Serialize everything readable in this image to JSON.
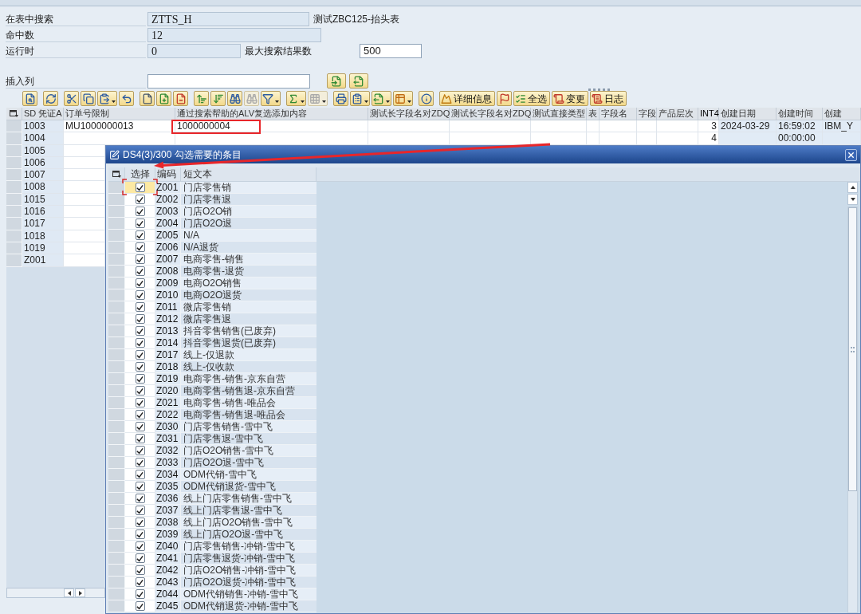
{
  "form": {
    "table_search": {
      "label": "在表中搜索",
      "value": "ZTTS_H",
      "read_only": true,
      "description": "测试ZBC125-抬头表"
    },
    "hit_count": {
      "label": "命中数",
      "value": "12",
      "read_only": true
    },
    "runtime": {
      "label": "运行时",
      "value": "0",
      "read_only": true
    },
    "max_results": {
      "label": "最大搜索结果数",
      "value": "500",
      "read_only": false
    },
    "insert_column": {
      "label": "插入列",
      "read_only": false
    }
  },
  "toolbar": {
    "items": [
      {
        "kind": "icon",
        "disabled": false
      },
      {
        "kind": "icon",
        "disabled": false
      },
      {
        "kind": "icon",
        "disabled": false
      },
      {
        "kind": "icon",
        "disabled": false
      },
      {
        "kind": "icon",
        "disabled": false
      },
      {
        "kind": "icon",
        "disabled": false
      },
      {
        "kind": "icon",
        "disabled": false
      },
      {
        "kind": "icon",
        "disabled": false
      },
      {
        "kind": "icon",
        "disabled": false
      },
      {
        "kind": "icon",
        "disabled": false
      },
      {
        "kind": "icon",
        "disabled": false
      },
      {
        "kind": "icon",
        "disabled": false
      },
      {
        "kind": "icon",
        "disabled": true
      },
      {
        "kind": "icon",
        "disabled": false
      },
      {
        "kind": "icon",
        "disabled": false
      },
      {
        "kind": "icon",
        "disabled": true
      },
      {
        "kind": "icon",
        "disabled": false
      },
      {
        "kind": "icon",
        "disabled": false
      },
      {
        "kind": "icon",
        "disabled": false
      },
      {
        "kind": "icon",
        "disabled": false
      },
      {
        "kind": "icon",
        "disabled": false
      },
      {
        "kind": "text",
        "label": "详细信息",
        "disabled": false
      },
      {
        "kind": "icon",
        "disabled": false
      },
      {
        "kind": "text",
        "label": "全选",
        "disabled": false
      },
      {
        "kind": "text",
        "label": "变更",
        "disabled": false
      },
      {
        "kind": "text",
        "label": "日志",
        "disabled": false
      }
    ]
  },
  "table": {
    "columns": [
      "SD 凭证A",
      "订单号限制",
      "通过搜索帮助的ALV复选添加内容",
      "测试长字段名对ZDQ",
      "测试长字段名对ZDQ",
      "测试直接类型",
      "表",
      "字段名",
      "字段",
      "产品层次",
      "INT4",
      "创建日期",
      "创建时间",
      "创建"
    ],
    "rows": [
      {
        "sd_document": "1003",
        "order_number": "MU1000000013",
        "alv_content": "1000000004",
        "int4": "3",
        "created_date": "2024-03-29",
        "created_time": "16:59:02",
        "created_by": "IBM_Y"
      },
      {
        "sd_document": "1004",
        "int4": "4",
        "created_time": "00:00:00"
      },
      {
        "sd_document": "1005"
      },
      {
        "sd_document": "1006"
      },
      {
        "sd_document": "1007"
      },
      {
        "sd_document": "1008"
      },
      {
        "sd_document": "1015"
      },
      {
        "sd_document": "1016"
      },
      {
        "sd_document": "1017"
      },
      {
        "sd_document": "1018"
      },
      {
        "sd_document": "1019"
      },
      {
        "sd_document": "Z001"
      }
    ]
  },
  "dialog": {
    "title": "DS4(3)/300 勾选需要的条目",
    "columns": [
      "选择",
      "编码",
      "短文本"
    ],
    "rows": [
      {
        "code": "Z001",
        "text": "门店零售销",
        "checked": true,
        "focused": true
      },
      {
        "code": "Z002",
        "text": "门店零售退",
        "checked": true,
        "focused": false
      },
      {
        "code": "Z003",
        "text": "门店O2O销",
        "checked": true,
        "focused": false
      },
      {
        "code": "Z004",
        "text": "门店O2O退",
        "checked": true,
        "focused": false
      },
      {
        "code": "Z005",
        "text": "N/A",
        "checked": true,
        "focused": false
      },
      {
        "code": "Z006",
        "text": "N/A退货",
        "checked": true,
        "focused": false
      },
      {
        "code": "Z007",
        "text": "电商零售-销售",
        "checked": true,
        "focused": false
      },
      {
        "code": "Z008",
        "text": "电商零售-退货",
        "checked": true,
        "focused": false
      },
      {
        "code": "Z009",
        "text": "电商O2O销售",
        "checked": true,
        "focused": false
      },
      {
        "code": "Z010",
        "text": "电商O2O退货",
        "checked": true,
        "focused": false
      },
      {
        "code": "Z011",
        "text": "微店零售销",
        "checked": true,
        "focused": false
      },
      {
        "code": "Z012",
        "text": "微店零售退",
        "checked": true,
        "focused": false
      },
      {
        "code": "Z013",
        "text": "抖音零售销售(已废弃)",
        "checked": true,
        "focused": false
      },
      {
        "code": "Z014",
        "text": "抖音零售退货(已废弃)",
        "checked": true,
        "focused": false
      },
      {
        "code": "Z017",
        "text": "线上-仅退款",
        "checked": true,
        "focused": false
      },
      {
        "code": "Z018",
        "text": "线上-仅收款",
        "checked": true,
        "focused": false
      },
      {
        "code": "Z019",
        "text": "电商零售-销售-京东自营",
        "checked": true,
        "focused": false
      },
      {
        "code": "Z020",
        "text": "电商零售-销售退-京东自营",
        "checked": true,
        "focused": false
      },
      {
        "code": "Z021",
        "text": "电商零售-销售-唯品会",
        "checked": true,
        "focused": false
      },
      {
        "code": "Z022",
        "text": "电商零售-销售退-唯品会",
        "checked": true,
        "focused": false
      },
      {
        "code": "Z030",
        "text": "门店零售销售-雪中飞",
        "checked": true,
        "focused": false
      },
      {
        "code": "Z031",
        "text": "门店零售退-雪中飞",
        "checked": true,
        "focused": false
      },
      {
        "code": "Z032",
        "text": "门店O2O销售-雪中飞",
        "checked": true,
        "focused": false
      },
      {
        "code": "Z033",
        "text": "门店O2O退-雪中飞",
        "checked": true,
        "focused": false
      },
      {
        "code": "Z034",
        "text": "ODM代销-雪中飞",
        "checked": true,
        "focused": false
      },
      {
        "code": "Z035",
        "text": "ODM代销退货-雪中飞",
        "checked": true,
        "focused": false
      },
      {
        "code": "Z036",
        "text": "线上门店零售销售-雪中飞",
        "checked": true,
        "focused": false
      },
      {
        "code": "Z037",
        "text": "线上门店零售退-雪中飞",
        "checked": true,
        "focused": false
      },
      {
        "code": "Z038",
        "text": "线上门店O2O销售-雪中飞",
        "checked": true,
        "focused": false
      },
      {
        "code": "Z039",
        "text": "线上门店O2O退-雪中飞",
        "checked": true,
        "focused": false
      },
      {
        "code": "Z040",
        "text": "门店零售销售-冲销-雪中飞",
        "checked": true,
        "focused": false
      },
      {
        "code": "Z041",
        "text": "门店零售退货-冲销-雪中飞",
        "checked": true,
        "focused": false
      },
      {
        "code": "Z042",
        "text": "门店O2O销售-冲销-雪中飞",
        "checked": true,
        "focused": false
      },
      {
        "code": "Z043",
        "text": "门店O2O退货-冲销-雪中飞",
        "checked": true,
        "focused": false
      },
      {
        "code": "Z044",
        "text": "ODM代销销售-冲销-雪中飞",
        "checked": true,
        "focused": false
      },
      {
        "code": "Z045",
        "text": "ODM代销退货-冲销-雪中飞",
        "checked": true,
        "focused": false
      }
    ]
  }
}
